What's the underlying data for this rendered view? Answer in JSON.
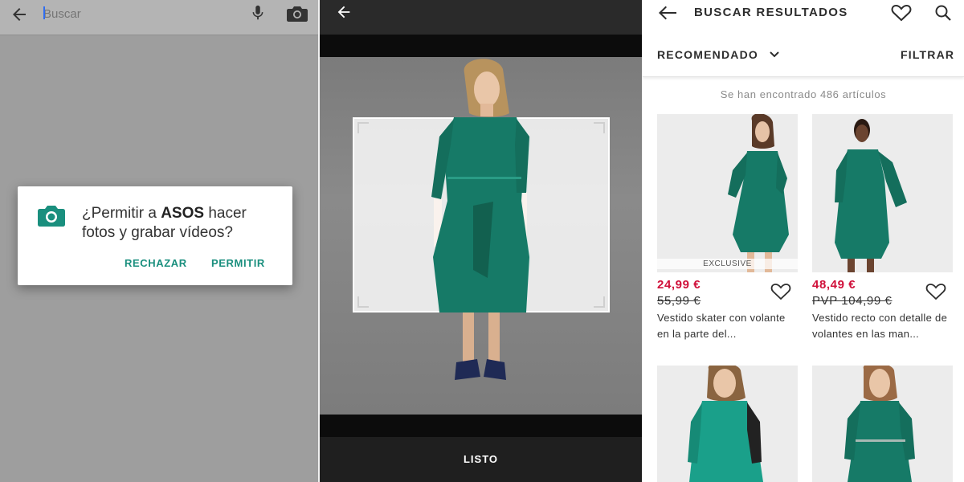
{
  "colors": {
    "accent_teal": "#1a8f7e",
    "sale_red": "#d0103a",
    "dress_green": "#167a67"
  },
  "left_panel": {
    "search_placeholder": "Buscar",
    "icons": [
      "back-arrow-icon",
      "microphone-icon",
      "camera-icon"
    ],
    "dialog": {
      "text_prefix": "¿Permitir a ",
      "app_name": "ASOS",
      "text_suffix": " hacer fotos y grabar vídeos?",
      "reject_label": "RECHAZAR",
      "allow_label": "PERMITIR",
      "icon": "camera-icon"
    }
  },
  "middle_panel": {
    "done_label": "LISTO",
    "icons": [
      "back-arrow-icon"
    ]
  },
  "right_panel": {
    "title": "BUSCAR RESULTADOS",
    "sort_label": "RECOMENDADO",
    "filter_label": "FILTRAR",
    "results_count": "Se han encontrado 486 artículos",
    "products": [
      {
        "badge": "EXCLUSIVE",
        "price": "24,99 €",
        "old_price": "55,99 €",
        "name": "Vestido skater con volante en la parte del..."
      },
      {
        "badge": "",
        "price": "48,49 €",
        "old_price": "PVP 104,99 €",
        "name": "Vestido recto con detalle de volantes en las man..."
      },
      {
        "badge": "",
        "price": "",
        "old_price": "",
        "name": ""
      },
      {
        "badge": "",
        "price": "",
        "old_price": "",
        "name": ""
      }
    ]
  }
}
